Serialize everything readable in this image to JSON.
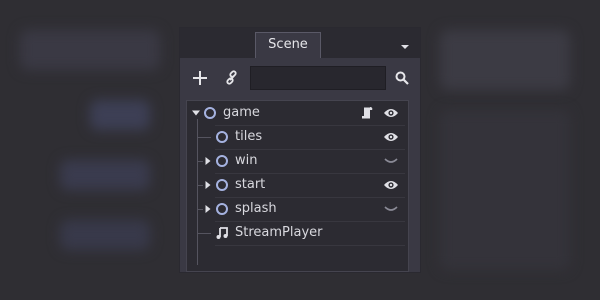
{
  "dock": {
    "tab_label": "Scene"
  },
  "filter": {
    "value": "",
    "placeholder": ""
  },
  "tree": {
    "nodes": [
      {
        "label": "game",
        "icon": "node-circle-icon",
        "expanded": true,
        "has_script": true,
        "visibility": "visible"
      },
      {
        "label": "tiles",
        "icon": "node-circle-icon",
        "visibility": "visible"
      },
      {
        "label": "win",
        "icon": "node-circle-icon",
        "expanded": false,
        "visibility": "hidden"
      },
      {
        "label": "start",
        "icon": "node-circle-icon",
        "expanded": false,
        "visibility": "visible"
      },
      {
        "label": "splash",
        "icon": "node-circle-icon",
        "expanded": false,
        "visibility": "hidden"
      },
      {
        "label": "StreamPlayer",
        "icon": "music-note-icon"
      }
    ]
  },
  "colors": {
    "node_ring": "#a5b2e0",
    "icon": "#e0e0e6",
    "muted_icon": "#8a8a96"
  }
}
